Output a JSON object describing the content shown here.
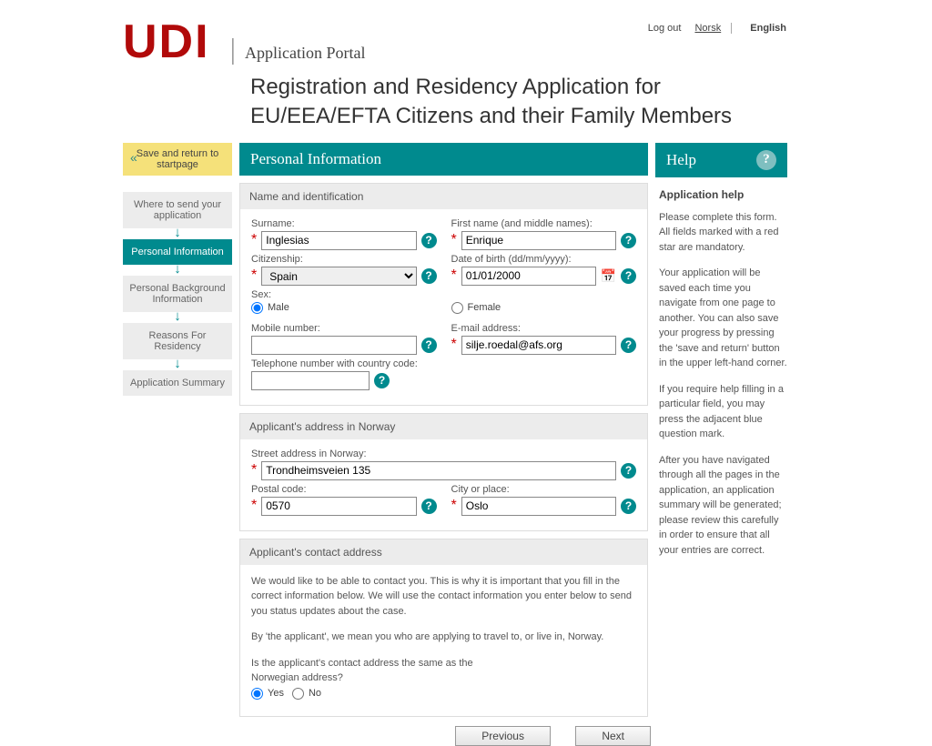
{
  "top": {
    "logout": "Log out",
    "norsk": "Norsk",
    "english": "English"
  },
  "logo": "UDI",
  "portal": "Application Portal",
  "heading": "Registration and Residency Application for EU/EEA/EFTA Citizens and their Family Members",
  "sidebar": {
    "save_return": "Save and return to startpage",
    "steps": [
      "Where to send your application",
      "Personal Information",
      "Personal Background Information",
      "Reasons For Residency",
      "Application Summary"
    ]
  },
  "form_title": "Personal Information",
  "help_title": "Help",
  "sections": {
    "name_id": {
      "title": "Name and identification",
      "surname_label": "Surname:",
      "surname_value": "Inglesias",
      "firstname_label": "First name (and middle names):",
      "firstname_value": "Enrique",
      "citizenship_label": "Citizenship:",
      "citizenship_value": "Spain",
      "dob_label": "Date of birth (dd/mm/yyyy):",
      "dob_value": "01/01/2000",
      "sex_label": "Sex:",
      "male": "Male",
      "female": "Female",
      "mobile_label": "Mobile number:",
      "mobile_value": "",
      "email_label": "E-mail address:",
      "email_value": "silje.roedal@afs.org",
      "tel_label": "Telephone number with country code:",
      "tel_value": ""
    },
    "addr_norway": {
      "title": "Applicant's address in Norway",
      "street_label": "Street address in Norway:",
      "street_value": "Trondheimsveien 135",
      "postal_label": "Postal code:",
      "postal_value": "0570",
      "city_label": "City or place:",
      "city_value": "Oslo"
    },
    "contact": {
      "title": "Applicant's contact address",
      "para1": "We would like to be able to contact you. This is why it is important that you fill in the correct information below. We will use the contact information you enter below to send you status updates about the case.",
      "para2": "By 'the applicant', we mean you who are applying to travel to, or live in, Norway.",
      "question": "Is the applicant's contact address the same as the Norwegian address?",
      "yes": "Yes",
      "no": "No"
    }
  },
  "help": {
    "subhead": "Application help",
    "p1": "Please complete this form. All fields marked with a red star are mandatory.",
    "p2": "Your application will be saved each time you navigate from one page to another. You can also save your progress by pressing the 'save and return' button in the upper left-hand corner.",
    "p3": "If you require help filling in a particular field, you may press the adjacent blue question mark.",
    "p4": "After you have navigated through all the pages in the application, an application summary will be generated; please review this carefully in order to ensure that all your entries are correct."
  },
  "buttons": {
    "prev": "Previous",
    "next": "Next"
  }
}
